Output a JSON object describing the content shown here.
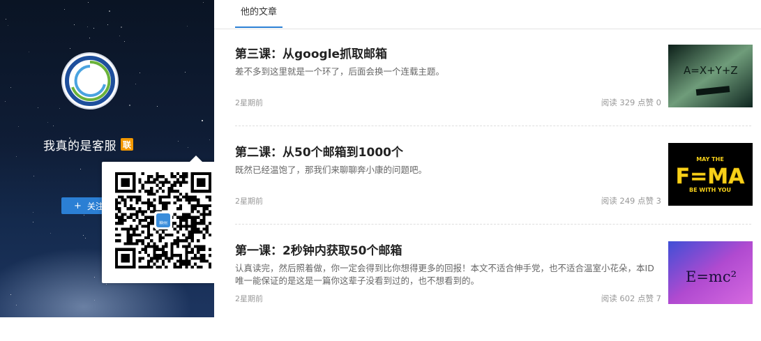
{
  "profile": {
    "name": "我真的是客服",
    "badge": "联",
    "follow_label": "关注",
    "follow_icon": "plus-icon",
    "avatar_icon": "swirl-logo-icon"
  },
  "qr_popup": {
    "logo_text": "神州"
  },
  "tabs": {
    "active": "他的文章"
  },
  "articles": [
    {
      "title": "第三课：从google抓取邮箱",
      "excerpt": "差不多到这里就是一个环了，后面会换一个连载主题。",
      "time": "2星期前",
      "stats": "阅读 329  点赞 0",
      "thumb_text": "A=X+Y+Z"
    },
    {
      "title": "第二课：从50个邮箱到1000个",
      "excerpt": "既然已经温饱了，那我们来聊聊奔小康的问题吧。",
      "time": "2星期前",
      "stats": "阅读 249  点赞 3",
      "thumb_text": "F=MA",
      "thumb_top": "MAY THE",
      "thumb_bottom": "BE WITH YOU"
    },
    {
      "title": "第一课：2秒钟内获取50个邮箱",
      "excerpt": "认真读完，然后照着做，你一定会得到比你想得更多的回报！本文不适合伸手党，也不适合温室小花朵，本ID唯一能保证的是这是一篇你这辈子没看到过的，也不想看到的。",
      "time": "2星期前",
      "stats": "阅读 602  点赞 7",
      "thumb_text": "E=mc²"
    }
  ]
}
